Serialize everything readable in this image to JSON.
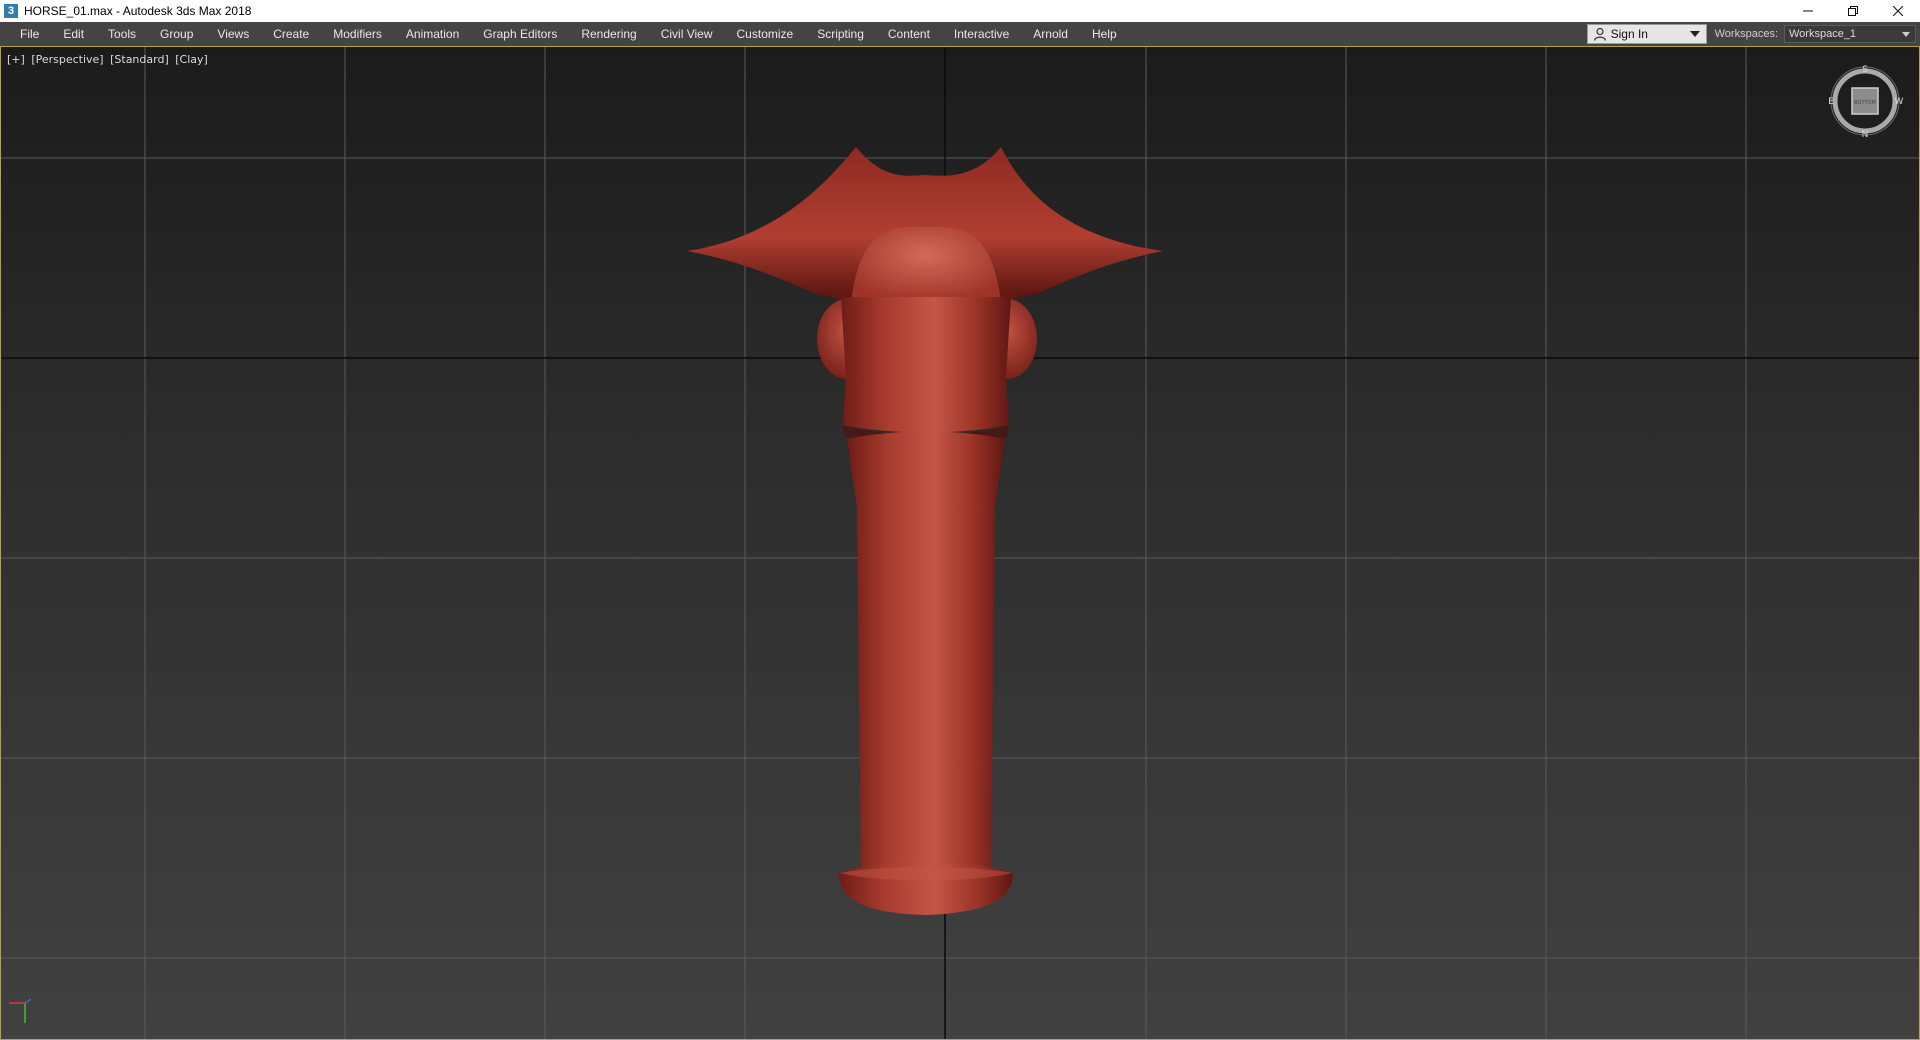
{
  "window": {
    "title": "HORSE_01.max - Autodesk 3ds Max 2018",
    "app_icon": "3"
  },
  "menu": {
    "items": [
      "File",
      "Edit",
      "Tools",
      "Group",
      "Views",
      "Create",
      "Modifiers",
      "Animation",
      "Graph Editors",
      "Rendering",
      "Civil View",
      "Customize",
      "Scripting",
      "Content",
      "Interactive",
      "Arnold",
      "Help"
    ]
  },
  "signin": {
    "label": "Sign In"
  },
  "workspace": {
    "label": "Workspaces:",
    "value": "Workspace_1"
  },
  "viewport": {
    "label_parts": [
      "[+]",
      "[Perspective]",
      "[Standard]",
      "[Clay]"
    ],
    "viewcube": {
      "top": "S",
      "bottom": "N",
      "left": "E",
      "right": "W",
      "face": "BOTTOM"
    },
    "colors": {
      "model": "#a8372c",
      "border": "#b9a244",
      "grid": "#5b5b5b",
      "axis_line": "#0a0a0a"
    }
  }
}
